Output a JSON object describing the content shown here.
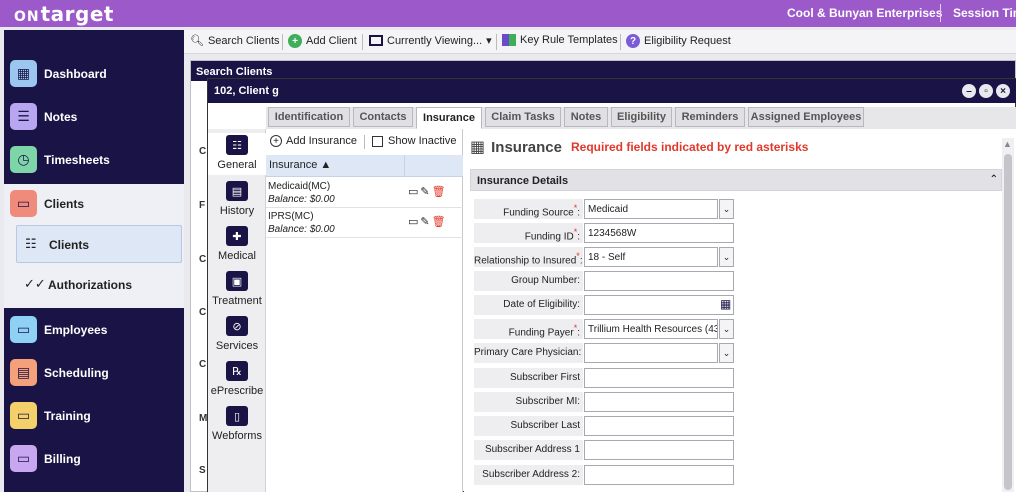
{
  "app": {
    "logo_prefix": "ON",
    "logo_text": "target",
    "org": "Cool & Bunyan Enterprises",
    "session": "Session Tim"
  },
  "colors": {
    "topbar": "#9b59c9",
    "navy": "#1a1446",
    "required": "#e0392b"
  },
  "sidebar": {
    "items": [
      {
        "label": "Dashboard",
        "icon": "dashboard-icon",
        "color": "#9bc6f0"
      },
      {
        "label": "Notes",
        "icon": "notes-icon",
        "color": "#b9a6f0"
      },
      {
        "label": "Timesheets",
        "icon": "clock-icon",
        "color": "#7ed6a8"
      },
      {
        "label": "Clients",
        "icon": "folder-icon",
        "color": "#f08a7a"
      },
      {
        "label": "Employees",
        "icon": "folder-icon",
        "color": "#8fd1f5"
      },
      {
        "label": "Scheduling",
        "icon": "calendar-icon",
        "color": "#f4a07a"
      },
      {
        "label": "Training",
        "icon": "folder-icon",
        "color": "#f4d06a"
      },
      {
        "label": "Billing",
        "icon": "folder-icon",
        "color": "#c9a6f0"
      }
    ],
    "sub_items": [
      {
        "label": "Clients",
        "icon": "client-list-icon"
      },
      {
        "label": "Authorizations",
        "icon": "checkmarks-icon"
      }
    ]
  },
  "toolbar": {
    "search_clients": "Search Clients",
    "add_client": "Add Client",
    "currently_viewing": "Currently Viewing...",
    "key_rule_templates": "Key Rule Templates",
    "eligibility_request": "Eligibility Request"
  },
  "search_panel": {
    "title": "Search Clients",
    "bg_letters": [
      "C",
      "F",
      "C",
      "C",
      "C",
      "M",
      "S"
    ]
  },
  "modal": {
    "title": "102, Client g",
    "tabs": [
      "Identification",
      "Contacts",
      "Insurance",
      "Claim Tasks",
      "Notes",
      "Eligibility",
      "Reminders",
      "Assigned Employees"
    ],
    "active_tab": "Insurance",
    "rail": [
      {
        "label": "General",
        "icon": "general-icon"
      },
      {
        "label": "History",
        "icon": "history-icon"
      },
      {
        "label": "Medical",
        "icon": "medical-cross-icon"
      },
      {
        "label": "Treatment",
        "icon": "treatment-icon"
      },
      {
        "label": "Services",
        "icon": "services-icon"
      },
      {
        "label": "ePrescribe",
        "icon": "prescription-icon"
      },
      {
        "label": "Webforms",
        "icon": "webforms-icon"
      }
    ],
    "ins_list": {
      "add_label": "Add Insurance",
      "show_inactive": "Show Inactive",
      "column": "Insurance",
      "rows": [
        {
          "name": "Medicaid(MC)",
          "balance": "Balance: $0.00"
        },
        {
          "name": "IPRS(MC)",
          "balance": "Balance: $0.00"
        }
      ]
    },
    "detail": {
      "title": "Insurance",
      "required_note": "Required fields indicated by red asterisks",
      "section": "Insurance Details",
      "fields": [
        {
          "label": "Funding Source",
          "value": "Medicaid"
        },
        {
          "label": "Funding ID",
          "value": "1234568W"
        },
        {
          "label": "Relationship to Insured",
          "value": "18 - Self"
        },
        {
          "label": "Group Number:",
          "value": ""
        },
        {
          "label": "Date of Eligibility:",
          "value": ""
        },
        {
          "label": "Funding Payer",
          "value": "Trillium Health Resources (43"
        },
        {
          "label": "Primary Care Physician:",
          "value": ""
        },
        {
          "label": "Subscriber First",
          "value": ""
        },
        {
          "label": "Subscriber MI:",
          "value": ""
        },
        {
          "label": "Subscriber Last",
          "value": ""
        },
        {
          "label": "Subscriber Address 1",
          "value": ""
        },
        {
          "label": "Subscriber Address 2:",
          "value": ""
        }
      ]
    }
  }
}
